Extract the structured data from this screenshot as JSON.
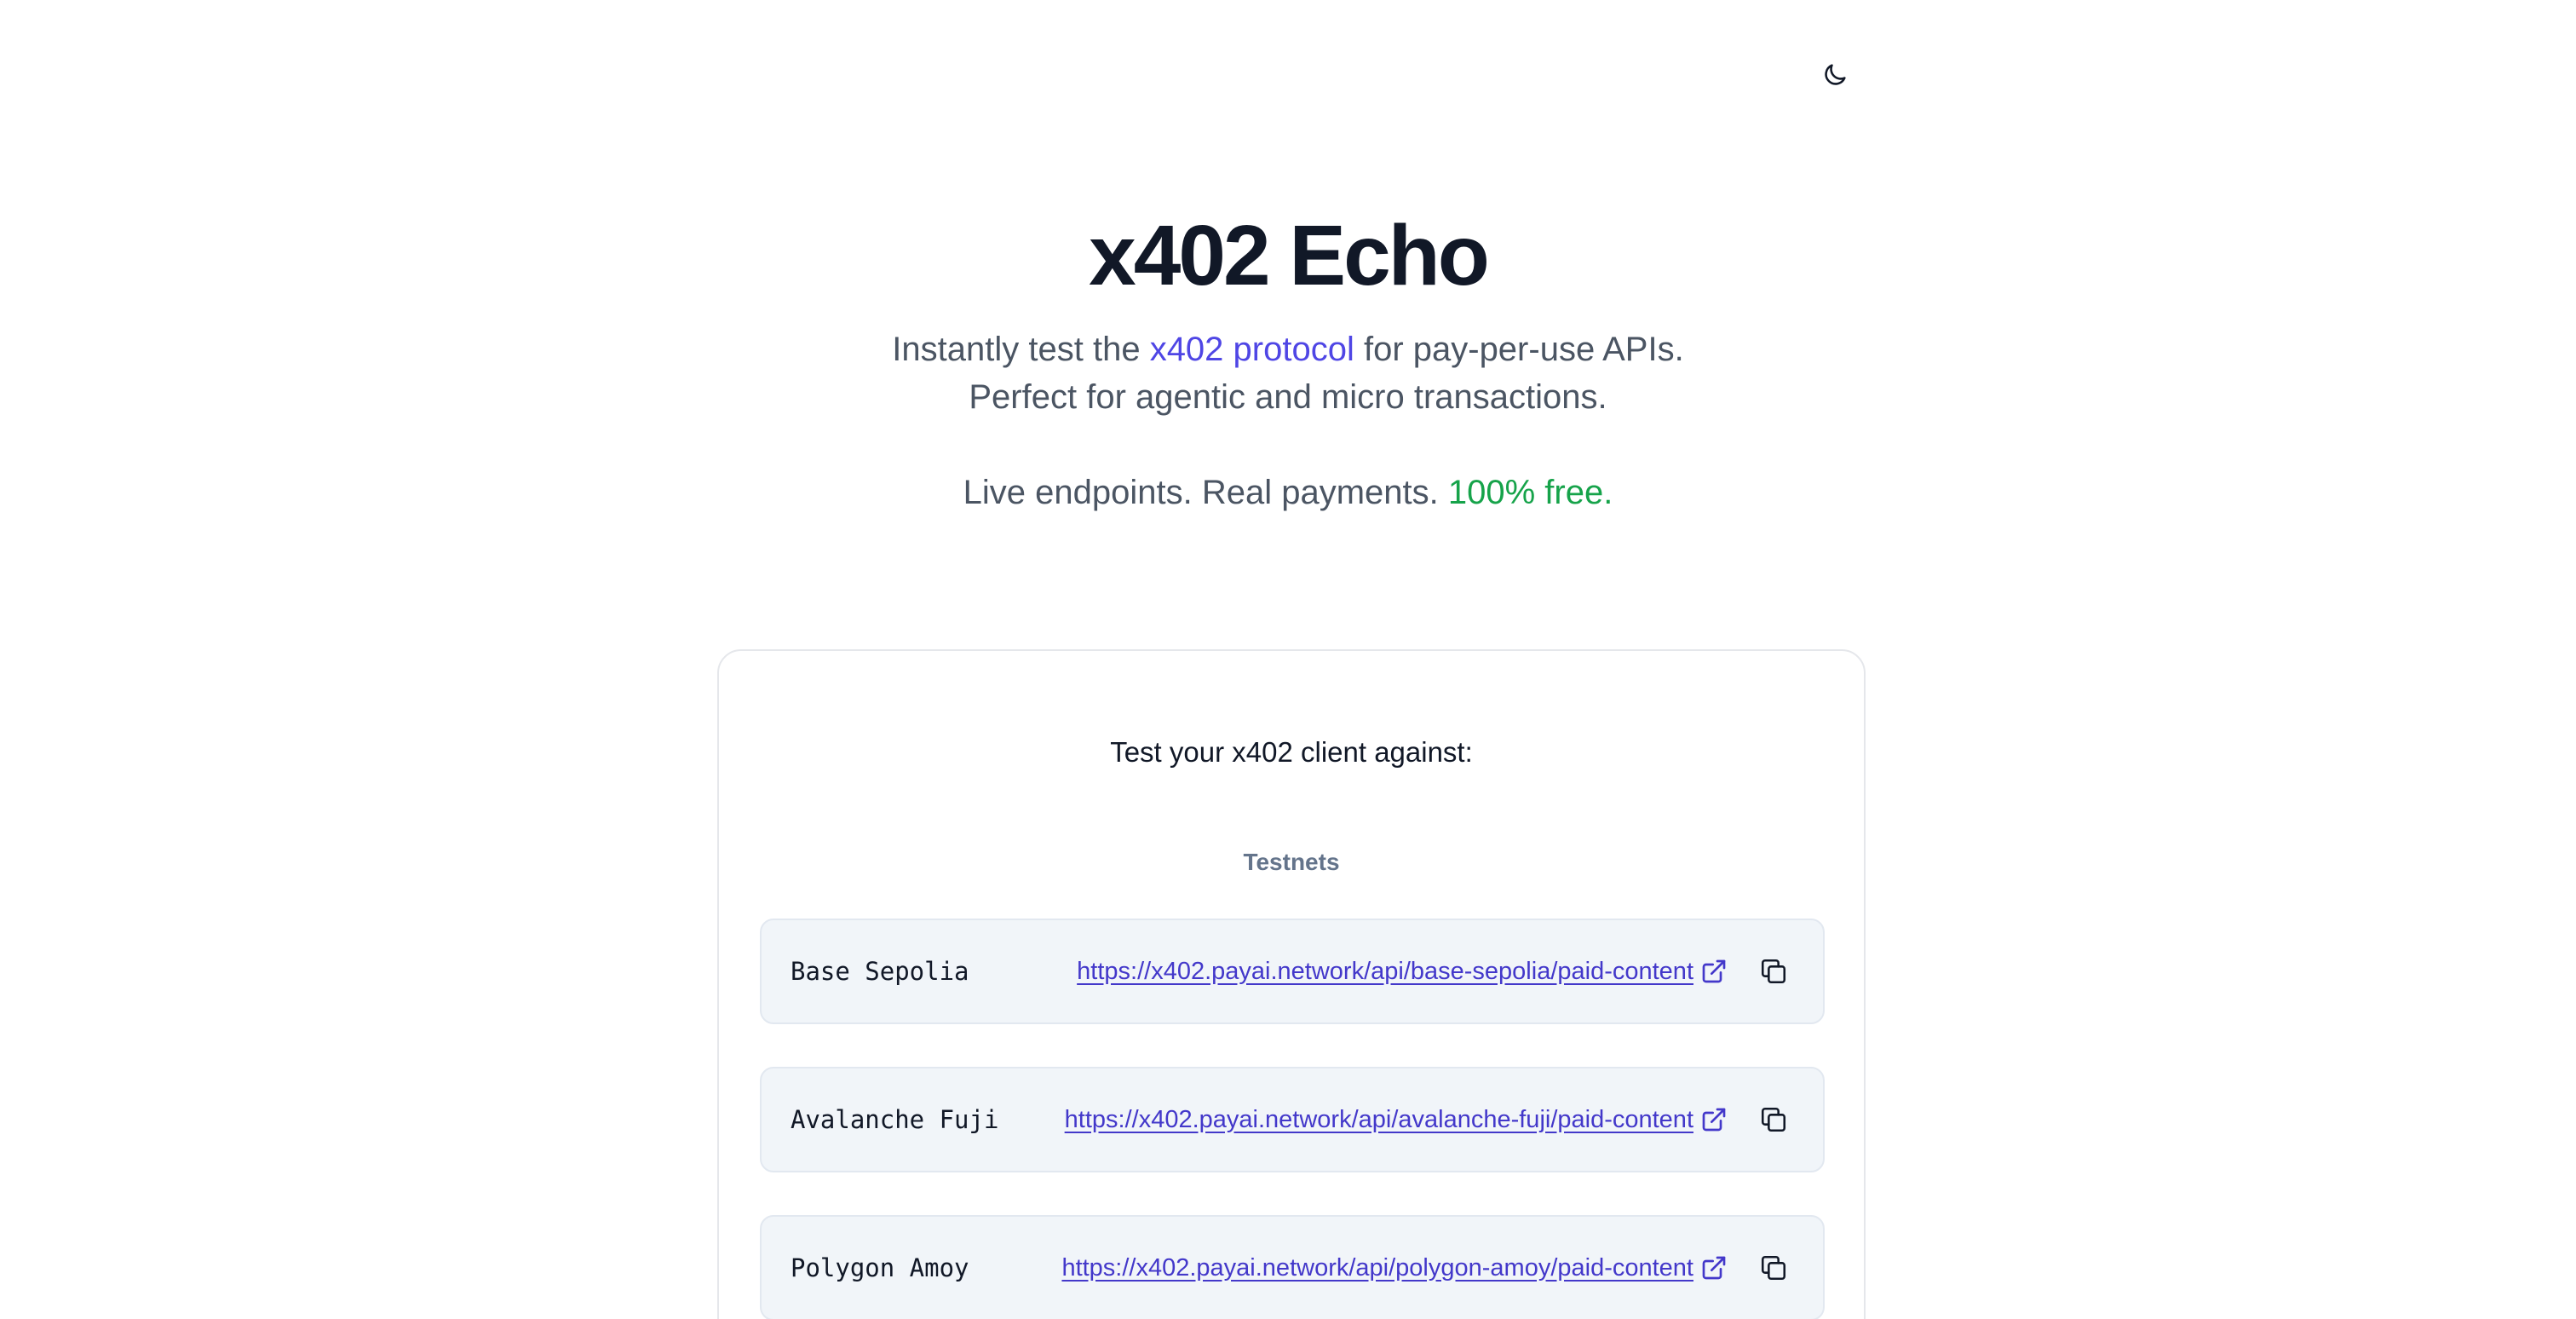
{
  "header": {
    "theme_toggle_icon": "moon-icon"
  },
  "hero": {
    "title": "x402 Echo",
    "subtitle_pre": "Instantly test the ",
    "subtitle_link": "x402 protocol",
    "subtitle_post": " for pay-per-use APIs.",
    "subtitle_line2": "Perfect for agentic and micro transactions.",
    "tagline_pre": "Live endpoints. Real payments. ",
    "tagline_free": "100% free."
  },
  "card": {
    "title": "Test your x402 client against:",
    "section_title": "Testnets",
    "endpoints": [
      {
        "network": "Base Sepolia",
        "url": "https://x402.payai.network/api/base-sepolia/paid-content"
      },
      {
        "network": "Avalanche Fuji",
        "url": "https://x402.payai.network/api/avalanche-fuji/paid-content"
      },
      {
        "network": "Polygon Amoy",
        "url": "https://x402.payai.network/api/polygon-amoy/paid-content"
      }
    ]
  },
  "colors": {
    "accent": "#4f46e5",
    "link": "#4338ca",
    "free": "#16a34a",
    "muted": "#64748b",
    "endpoint_bg": "#f1f5f9"
  },
  "icons": {
    "external": "external-link-icon",
    "copy": "copy-icon"
  }
}
